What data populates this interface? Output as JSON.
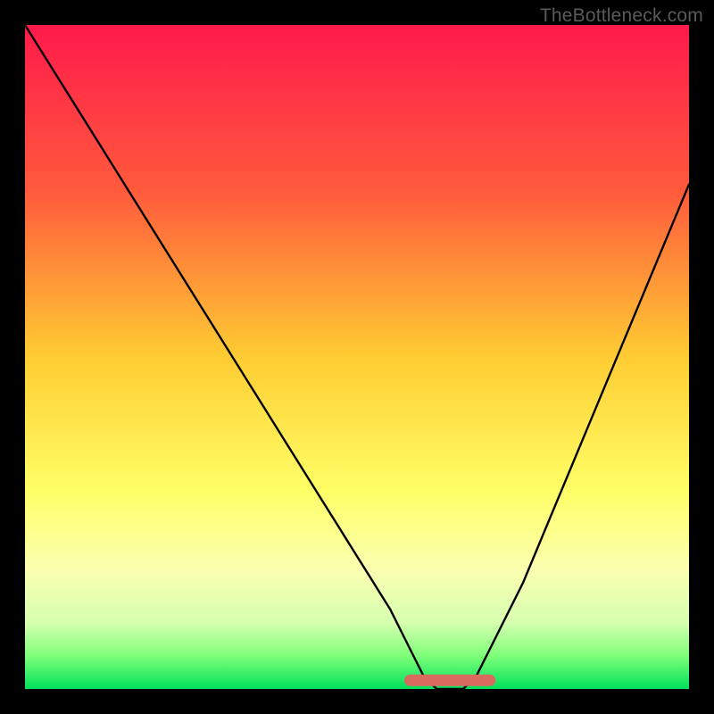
{
  "watermark": "TheBottleneck.com",
  "chart_data": {
    "type": "line",
    "title": "",
    "xlabel": "",
    "ylabel": "",
    "xlim": [
      0,
      100
    ],
    "ylim": [
      0,
      100
    ],
    "grid": false,
    "legend": false,
    "series": [
      {
        "name": "bottleneck-curve",
        "x": [
          0,
          5,
          10,
          15,
          20,
          25,
          30,
          35,
          40,
          45,
          50,
          55,
          58,
          60,
          62,
          64,
          66,
          68,
          70,
          75,
          80,
          85,
          90,
          95,
          100
        ],
        "y": [
          100,
          92,
          84,
          76,
          68,
          60,
          52,
          44,
          36,
          28,
          20,
          12,
          6,
          2,
          0,
          0,
          0,
          2,
          6,
          16,
          28,
          40,
          52,
          64,
          76
        ]
      }
    ],
    "highlight": {
      "name": "optimal-zone",
      "x": [
        58,
        70
      ],
      "y": [
        1.3,
        1.3
      ],
      "color": "#d96a5f"
    },
    "gradient_stops": [
      {
        "pos": 0.0,
        "color": "#ff1a4b"
      },
      {
        "pos": 0.25,
        "color": "#ff5a3c"
      },
      {
        "pos": 0.5,
        "color": "#ffcc33"
      },
      {
        "pos": 0.7,
        "color": "#ffff66"
      },
      {
        "pos": 0.82,
        "color": "#fbffb0"
      },
      {
        "pos": 0.9,
        "color": "#d6ffb0"
      },
      {
        "pos": 0.95,
        "color": "#7fff7a"
      },
      {
        "pos": 1.0,
        "color": "#00e05a"
      }
    ]
  }
}
